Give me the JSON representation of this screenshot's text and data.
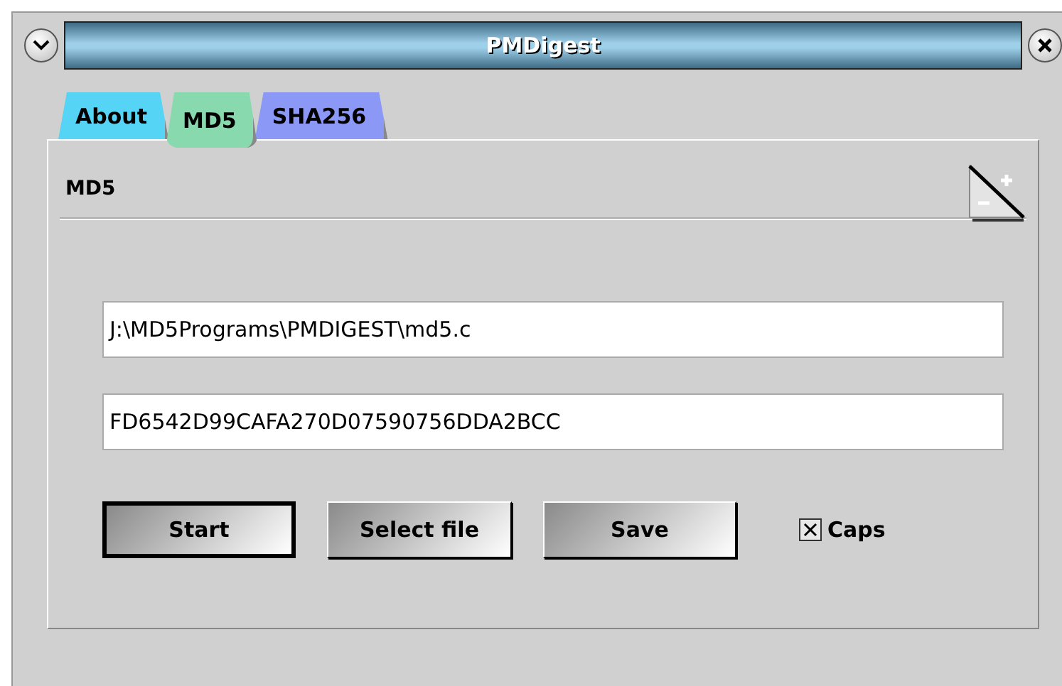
{
  "window": {
    "title": "PMDigest"
  },
  "tabs": [
    {
      "label": "About",
      "color": "#55d4f5",
      "selected": false
    },
    {
      "label": "MD5",
      "color": "#88d9ad",
      "selected": true
    },
    {
      "label": "SHA256",
      "color": "#8c98f5",
      "selected": false
    }
  ],
  "page": {
    "heading": "MD5"
  },
  "fields": [
    {
      "value": "J:\\MD5Programs\\PMDIGEST\\md5.c"
    },
    {
      "value": "FD6542D99CAFA270D07590756DDA2BCC"
    }
  ],
  "buttons": [
    {
      "label": "Start",
      "default": true
    },
    {
      "label": "Select file",
      "default": false
    },
    {
      "label": "Save",
      "default": false
    }
  ],
  "caps": {
    "label": "Caps",
    "checked": true
  }
}
